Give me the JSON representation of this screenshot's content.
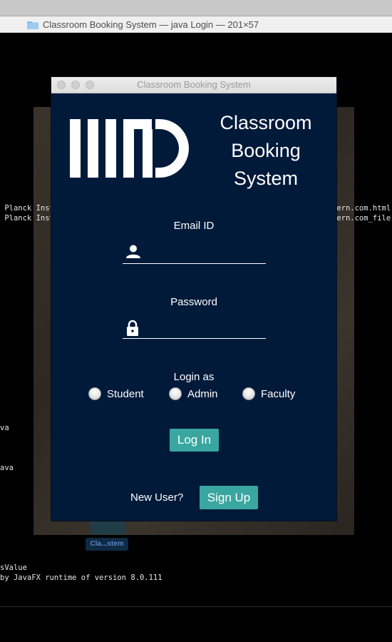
{
  "terminal": {
    "window_title": "Classroom Booking System — java Login — 201×57",
    "lines": [
      {
        "text": " Planck Inst"
      },
      {
        "text": " Planck Inst"
      },
      {
        "text": "tern.com.html"
      },
      {
        "text": "tern.com_file"
      },
      {
        "text": "va"
      },
      {
        "text": "ava"
      },
      {
        "text": "sValue"
      },
      {
        "text": "by JavaFX runtime of version 8.0.111"
      }
    ]
  },
  "dock": {
    "label": "Cla...stem"
  },
  "app": {
    "window_title": "Classroom Booking System",
    "title_lines": [
      "Classroom",
      "Booking",
      "System"
    ],
    "email": {
      "label": "Email ID",
      "value": "",
      "icon": "user-icon"
    },
    "password": {
      "label": "Password",
      "value": "",
      "icon": "lock-icon"
    },
    "login_as": {
      "label": "Login as",
      "options": [
        "Student",
        "Admin",
        "Faculty"
      ]
    },
    "login_button": "Log In",
    "new_user_text": "New User?",
    "signup_button": "Sign Up"
  },
  "colors": {
    "background": "#011a3a",
    "accent": "#3aa6a0"
  }
}
